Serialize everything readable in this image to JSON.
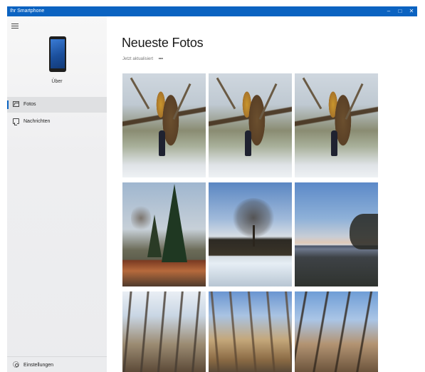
{
  "window": {
    "title": "Ihr Smartphone",
    "controls": [
      "–",
      "□",
      "✕"
    ]
  },
  "sidebar": {
    "device_name": "Über",
    "items": [
      {
        "label": "Fotos",
        "icon": "photo-icon",
        "active": true
      },
      {
        "label": "Nachrichten",
        "icon": "message-icon",
        "active": false
      }
    ],
    "settings_label": "Einstellungen"
  },
  "main": {
    "title": "Neueste Fotos",
    "subtitle": "Jetzt aktualisiert",
    "more": "•••",
    "photos": [
      {
        "subject": "tree-trunk-person"
      },
      {
        "subject": "tree-trunk-person"
      },
      {
        "subject": "tree-trunk-person"
      },
      {
        "subject": "spruce-tree"
      },
      {
        "subject": "bare-tree-snow"
      },
      {
        "subject": "dusk-field"
      },
      {
        "subject": "forest"
      },
      {
        "subject": "forest"
      },
      {
        "subject": "forest"
      }
    ]
  },
  "colors": {
    "accent": "#0b63c1",
    "sidebar_bg": "#eeeef0",
    "active_item_bg": "#dfe0e2"
  }
}
